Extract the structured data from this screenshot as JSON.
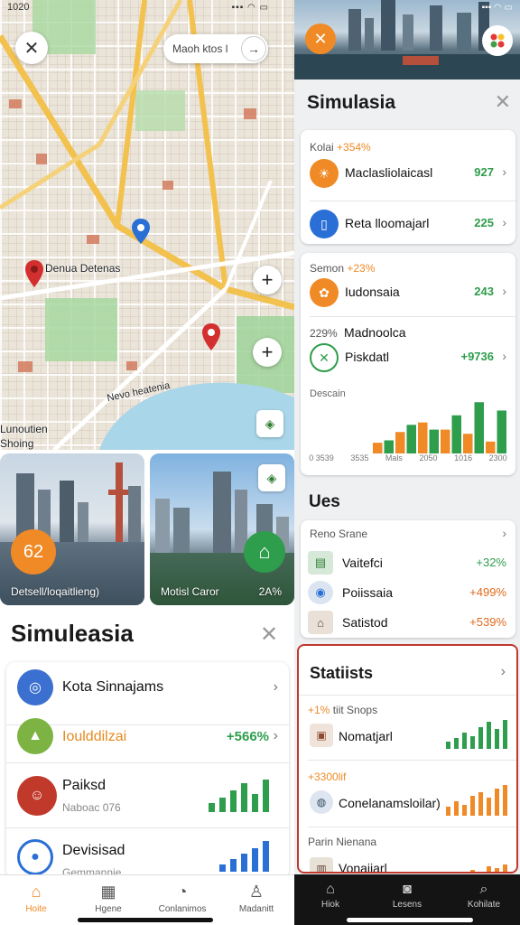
{
  "status": {
    "time": "1020",
    "signal": "▪▪▪ ◠ ▭"
  },
  "map": {
    "search_placeholder": "Maoh ktos l",
    "labels": {
      "pin_label": "Denua Detenas",
      "road_label": "Nevo heatenia",
      "edge_label_1": "Lunoutien",
      "edge_label_2": "Shoing"
    },
    "buttons": {
      "close": "✕",
      "go": "→",
      "zoom_in": "+",
      "zoom_in_2": "+",
      "layers": "◈"
    }
  },
  "photos": [
    {
      "caption": "Detsell/loqaitlieng)",
      "badge": "62"
    },
    {
      "caption": "Motisl Caror",
      "value": "2A%"
    }
  ],
  "sheet": {
    "title": "Simuleasia",
    "close": "✕",
    "rows": [
      {
        "title": "Kota Sinnajams",
        "icon": "globe-icon"
      },
      {
        "title": "Ioulddilzai",
        "value": "+566%",
        "icon": "person-icon"
      },
      {
        "title": "Paiksd",
        "subtitle": "Naboac 076",
        "icon": "avatar"
      },
      {
        "title": "Devisisad",
        "subtitle": "Gemmannie",
        "icon": "location-icon"
      }
    ]
  },
  "tabbar_left": [
    {
      "label": "Hoite",
      "icon": "home-icon",
      "active": true
    },
    {
      "label": "Hgene",
      "icon": "grid-icon",
      "active": false
    },
    {
      "label": "Conlanimos",
      "icon": "compass-icon",
      "active": false
    },
    {
      "label": "Madanitt",
      "icon": "user-icon",
      "active": false
    }
  ],
  "right": {
    "title": "Simulasia",
    "close": "✕",
    "card1": {
      "header_label": "Kolai",
      "header_value": "+354%",
      "rows": [
        {
          "label": "Maclasliolaicasl",
          "value": "927",
          "color": "#2e9d4c"
        },
        {
          "label": "Reta lloomajarl",
          "value": "225",
          "color": "#2e9d4c"
        }
      ]
    },
    "card2": {
      "header_label": "Semon",
      "header_value": "+23%",
      "rows": [
        {
          "label": "Iudonsaia",
          "value": "243",
          "color": "#2e9d4c"
        },
        {
          "label": "Piskdatl",
          "value": "+9736",
          "color": "#2e9d4c",
          "pre_label": "229%",
          "pre_title": "Madnoolca"
        }
      ],
      "chart_label": "Descain"
    },
    "uses": {
      "title": "Ues",
      "header": "Reno Srane",
      "rows": [
        {
          "label": "Vaitefci",
          "value": "+32%",
          "color": "#2e9d4c"
        },
        {
          "label": "Poiissaia",
          "value": "+499%",
          "color": "#e06a1b"
        },
        {
          "label": "Satistod",
          "value": "+539%",
          "color": "#e06a1b"
        }
      ]
    },
    "stats": {
      "title": "Statiists",
      "rows": [
        {
          "sub_prefix": "+1%",
          "sub": "tiit Snops",
          "label": "Nomatjarl"
        },
        {
          "sub_prefix": "+3300lif",
          "sub": "",
          "label": "Conelanamsloilar)"
        },
        {
          "sub_prefix": "",
          "sub": "Parin Nienana",
          "label": "Vonaiiarl"
        }
      ]
    }
  },
  "tabbar_right": [
    {
      "label": "Hiok",
      "icon": "home-icon"
    },
    {
      "label": "Lesens",
      "icon": "camera-icon"
    },
    {
      "label": "Kohilate",
      "icon": "search-icon"
    }
  ],
  "colors": {
    "accent": "#ef8a26",
    "green": "#2e9d4c",
    "blue": "#2a6fd6",
    "highlight": "#c0392b"
  },
  "chart_data": {
    "type": "bar",
    "title": "",
    "categories": [
      "0 3539",
      "3535",
      "Mals",
      "2050",
      "1016",
      "2300"
    ],
    "series": [
      {
        "name": "",
        "values": [
          18,
          36,
          52,
          40,
          33,
          20
        ],
        "color": "#ef8a26"
      },
      {
        "name": "",
        "values": [
          22,
          48,
          40,
          64,
          86,
          72
        ],
        "color": "#2e9d4c"
      }
    ],
    "xlabel": "",
    "ylabel": "",
    "ylim": [
      0,
      100
    ]
  }
}
